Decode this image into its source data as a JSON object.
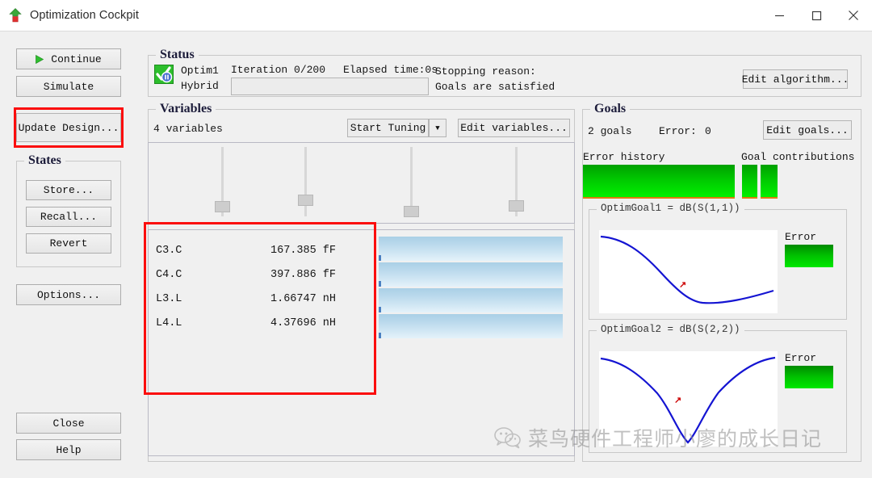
{
  "window": {
    "title": "Optimization Cockpit",
    "icon": "optimization-arrow-icon",
    "minimize_label": "—",
    "maximize_label": "□",
    "close_label": "✕"
  },
  "sidebar": {
    "continue_label": "Continue",
    "simulate_label": "Simulate",
    "update_design_label": "Update Design...",
    "states_group_label": "States",
    "store_label": "Store...",
    "recall_label": "Recall...",
    "revert_label": "Revert",
    "options_label": "Options...",
    "close_label": "Close",
    "help_label": "Help"
  },
  "status": {
    "group_label": "Status",
    "optim_name": "Optim1",
    "algorithm": "Hybrid",
    "iteration": "Iteration 0/200",
    "elapsed": "Elapsed time:0s",
    "stopping_reason_label": "Stopping reason:",
    "stopping_reason_value": "Goals are satisfied",
    "edit_algorithm_label": "Edit algorithm...",
    "progress_percent": 0
  },
  "variables": {
    "group_label": "Variables",
    "count_label": "4 variables",
    "start_tuning_label": "Start Tuning",
    "dropdown_arrow": "▼",
    "edit_variables_label": "Edit variables...",
    "sliders": [
      {
        "name": "C3.C",
        "position_pct": 72
      },
      {
        "name": "C4.C",
        "position_pct": 62
      },
      {
        "name": "L3.L",
        "position_pct": 77
      },
      {
        "name": "L4.L",
        "position_pct": 68
      }
    ],
    "rows": [
      {
        "name": "C3.C",
        "value": "167.385 fF",
        "bar_pct": 100
      },
      {
        "name": "C4.C",
        "value": "397.886 fF",
        "bar_pct": 100
      },
      {
        "name": "L3.L",
        "value": "1.66747 nH",
        "bar_pct": 100
      },
      {
        "name": "L4.L",
        "value": "4.37696 nH",
        "bar_pct": 100
      }
    ]
  },
  "goals": {
    "group_label": "Goals",
    "count_label": "2 goals",
    "error_label": "Error:",
    "error_value": "0",
    "edit_goals_label": "Edit goals...",
    "error_history_label": "Error history",
    "goal_contributions_label": "Goal contributions",
    "contributions": [
      100,
      100
    ],
    "items": [
      {
        "title": "OptimGoal1 = dB(S(1,1))",
        "error_label": "Error",
        "error_level_pct": 100
      },
      {
        "title": "OptimGoal2 = dB(S(2,2))",
        "error_label": "Error",
        "error_level_pct": 100
      }
    ]
  },
  "annotations": {
    "accent_color": "#fb0d0d",
    "boxes": [
      {
        "name": "update-design-highlight"
      },
      {
        "name": "variables-table-highlight"
      }
    ]
  },
  "watermark": {
    "icon": "wechat-icon",
    "text": "菜鸟硬件工程师小廖的成长日记"
  },
  "chart_data": [
    {
      "type": "line",
      "title": "OptimGoal1 = dB(S(1,1))",
      "xlabel": "",
      "ylabel": "dB(S(1,1))",
      "series": [
        {
          "name": "dB(S(1,1))",
          "color": "#1414d2",
          "x": [
            0,
            10,
            20,
            30,
            40,
            50,
            60,
            70,
            80,
            85,
            90,
            100
          ],
          "y": [
            95,
            91,
            84,
            72,
            55,
            38,
            24,
            16,
            13,
            13,
            15,
            22
          ]
        }
      ],
      "annotations": [
        {
          "name": "goal-marker",
          "x": 45,
          "y": 30,
          "color": "#cc0000"
        }
      ],
      "grid": false,
      "legend": "none"
    },
    {
      "type": "line",
      "title": "OptimGoal2 = dB(S(2,2))",
      "xlabel": "",
      "ylabel": "dB(S(2,2))",
      "series": [
        {
          "name": "dB(S(2,2))",
          "color": "#1414d2",
          "x": [
            0,
            10,
            20,
            30,
            40,
            46,
            50,
            54,
            60,
            70,
            80,
            90,
            100
          ],
          "y": [
            95,
            92,
            85,
            74,
            52,
            20,
            2,
            22,
            54,
            76,
            87,
            93,
            96
          ]
        }
      ],
      "annotations": [
        {
          "name": "goal-marker",
          "x": 42,
          "y": 40,
          "color": "#cc0000"
        }
      ],
      "grid": false,
      "legend": "none"
    },
    {
      "type": "bar",
      "title": "Error history",
      "categories": [
        "history"
      ],
      "values": [
        100
      ],
      "ylim": [
        0,
        100
      ],
      "color": "#00e000"
    },
    {
      "type": "bar",
      "title": "Goal contributions",
      "categories": [
        "OptimGoal1",
        "OptimGoal2"
      ],
      "values": [
        100,
        100
      ],
      "ylim": [
        0,
        100
      ],
      "color": "#00e000"
    }
  ]
}
